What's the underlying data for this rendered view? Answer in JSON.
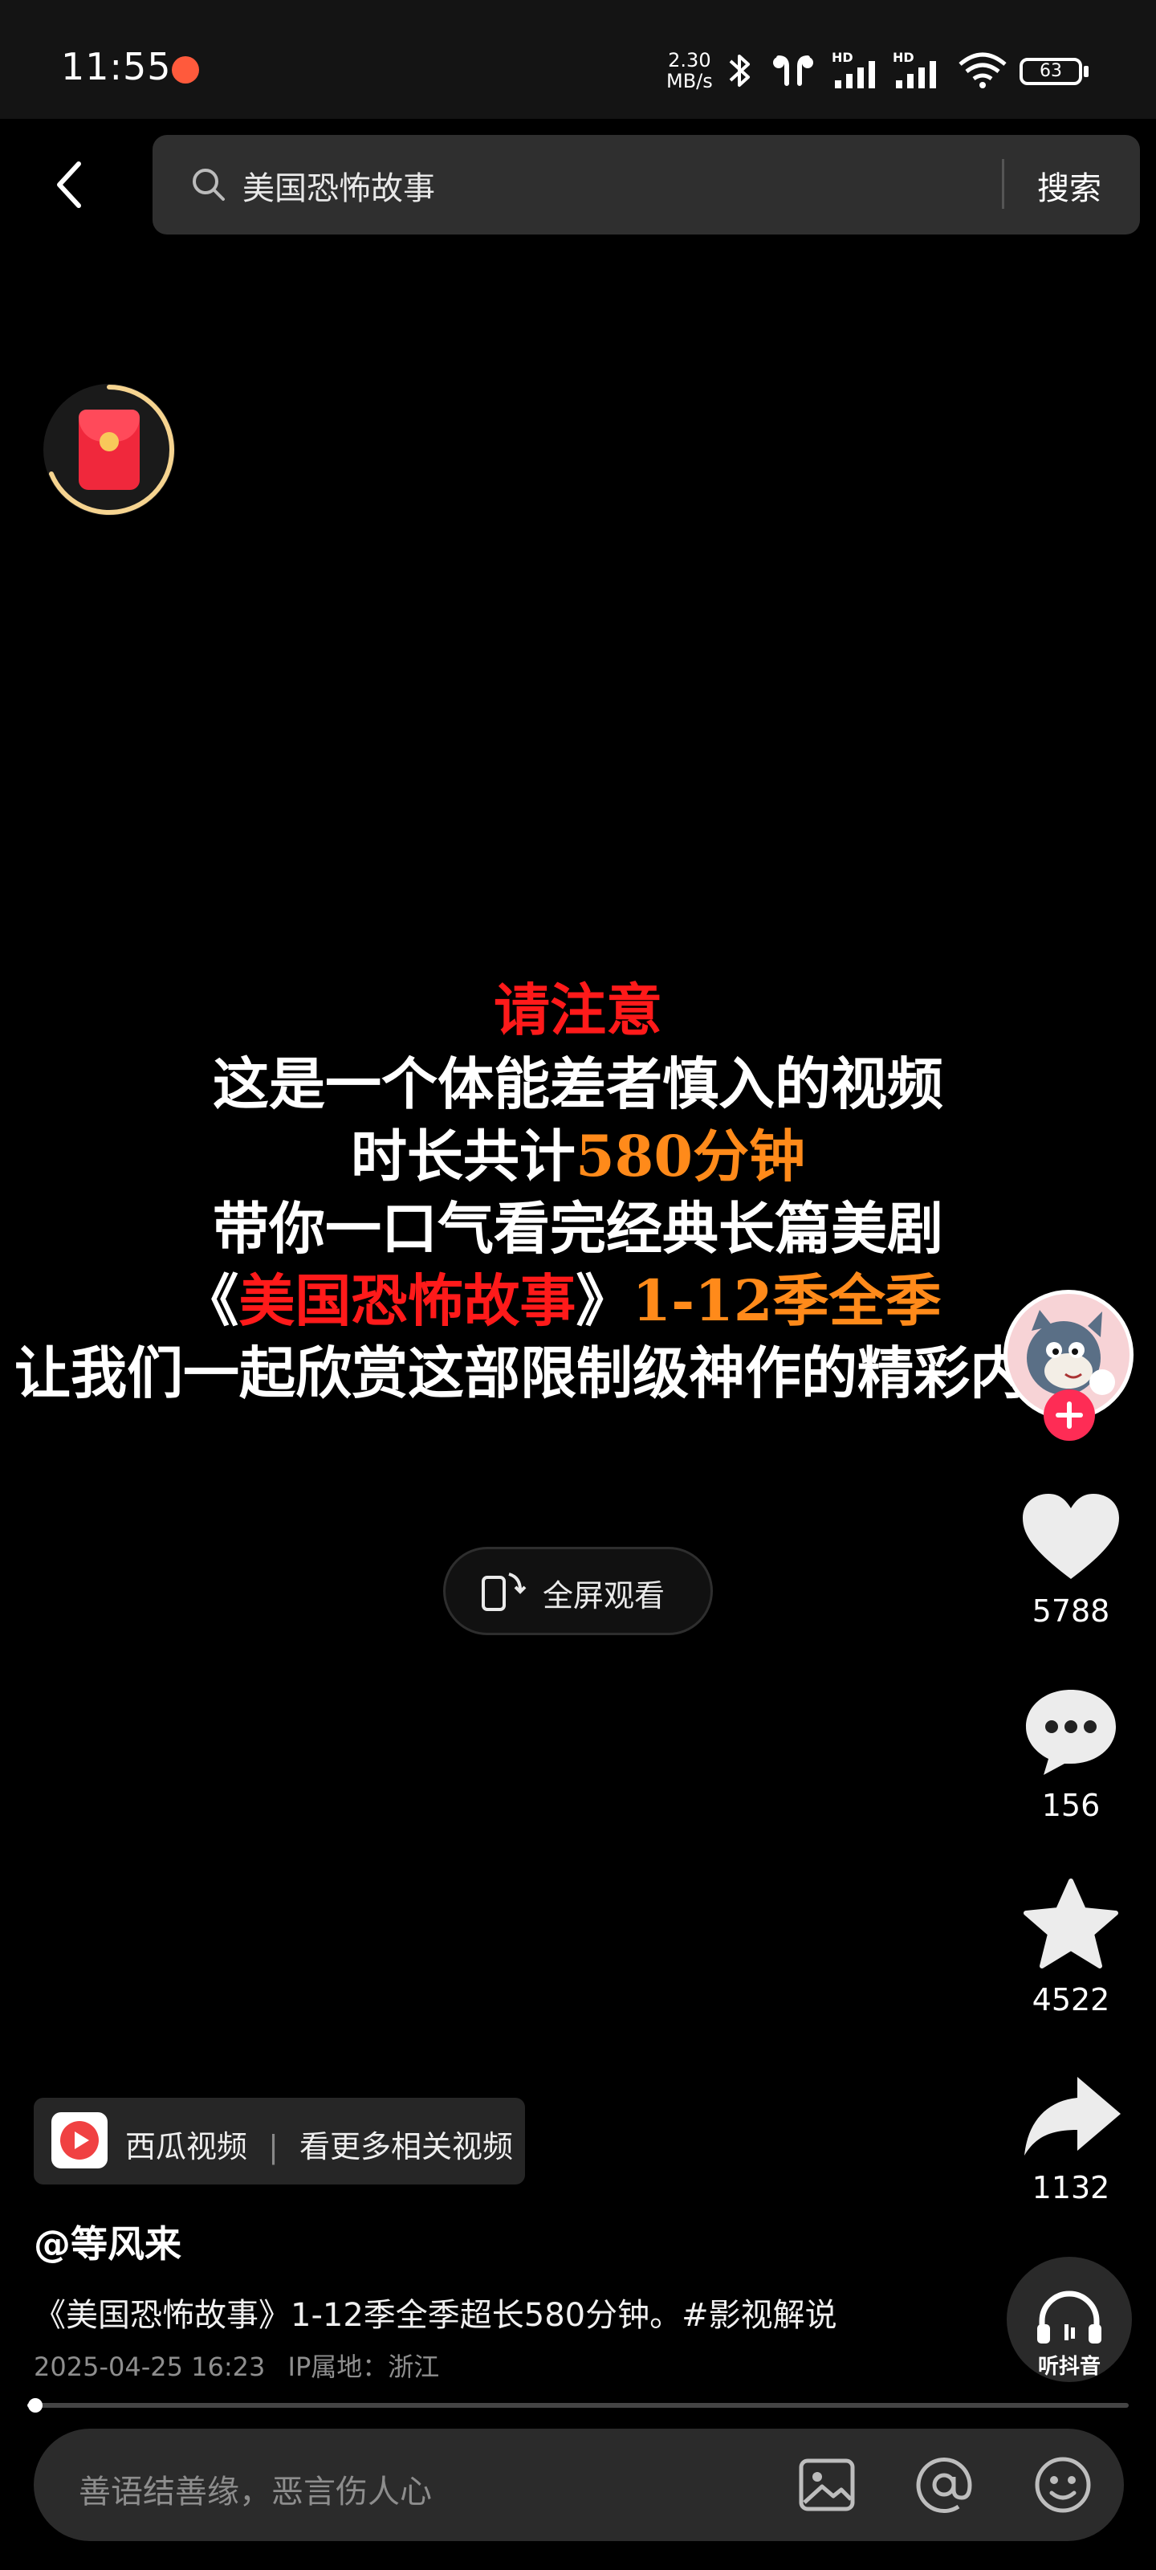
{
  "status_bar": {
    "time": "11:55",
    "net_speed_value": "2.30",
    "net_speed_unit": "MB/s",
    "battery": "63",
    "signal_1_label": "HD",
    "signal_2_label": "HD"
  },
  "search": {
    "query": "美国恐怖故事",
    "button_label": "搜索"
  },
  "video_overlay": {
    "line1": "请注意",
    "line2": "这是一个体能差者慎入的视频",
    "line3_prefix": "时长共计",
    "line3_highlight": "580分钟",
    "line4": "带你一口气看完经典长篇美剧",
    "line5_open": "《",
    "line5_title": "美国恐怖故事",
    "line5_close": "》",
    "line5_suffix": "1-12季全季",
    "line6": "让我们一起欣赏这部限制级神作的精彩内容"
  },
  "fullscreen_button": {
    "label": "全屏观看"
  },
  "actions": {
    "likes": "5788",
    "comments": "156",
    "favorites": "4522",
    "shares": "1132"
  },
  "listen_button": {
    "label": "听抖音"
  },
  "xigua_card": {
    "brand": "西瓜视频",
    "separator": "|",
    "link": "看更多相关视频"
  },
  "post": {
    "author": "@等风来",
    "caption": "《美国恐怖故事》1-12季全季超长580分钟。#影视解说",
    "date": "2025-04-25 16:23",
    "ip_location": "IP属地：浙江"
  },
  "playback": {
    "progress": 0.005
  },
  "comment_bar": {
    "placeholder": "善语结善缘，恶言伤人心"
  },
  "colors": {
    "accent_red": "#fe2c55",
    "overlay_red": "#ff1a1a",
    "overlay_orange": "#ff8a1a"
  },
  "icons": [
    "back-icon",
    "search-icon",
    "red-packet-icon",
    "heart-icon",
    "comment-icon",
    "star-icon",
    "share-icon",
    "headphones-icon",
    "rotate-screen-icon",
    "image-icon",
    "at-icon",
    "emoji-icon",
    "bluetooth-icon",
    "signal-icon",
    "wifi-icon",
    "battery-icon"
  ]
}
